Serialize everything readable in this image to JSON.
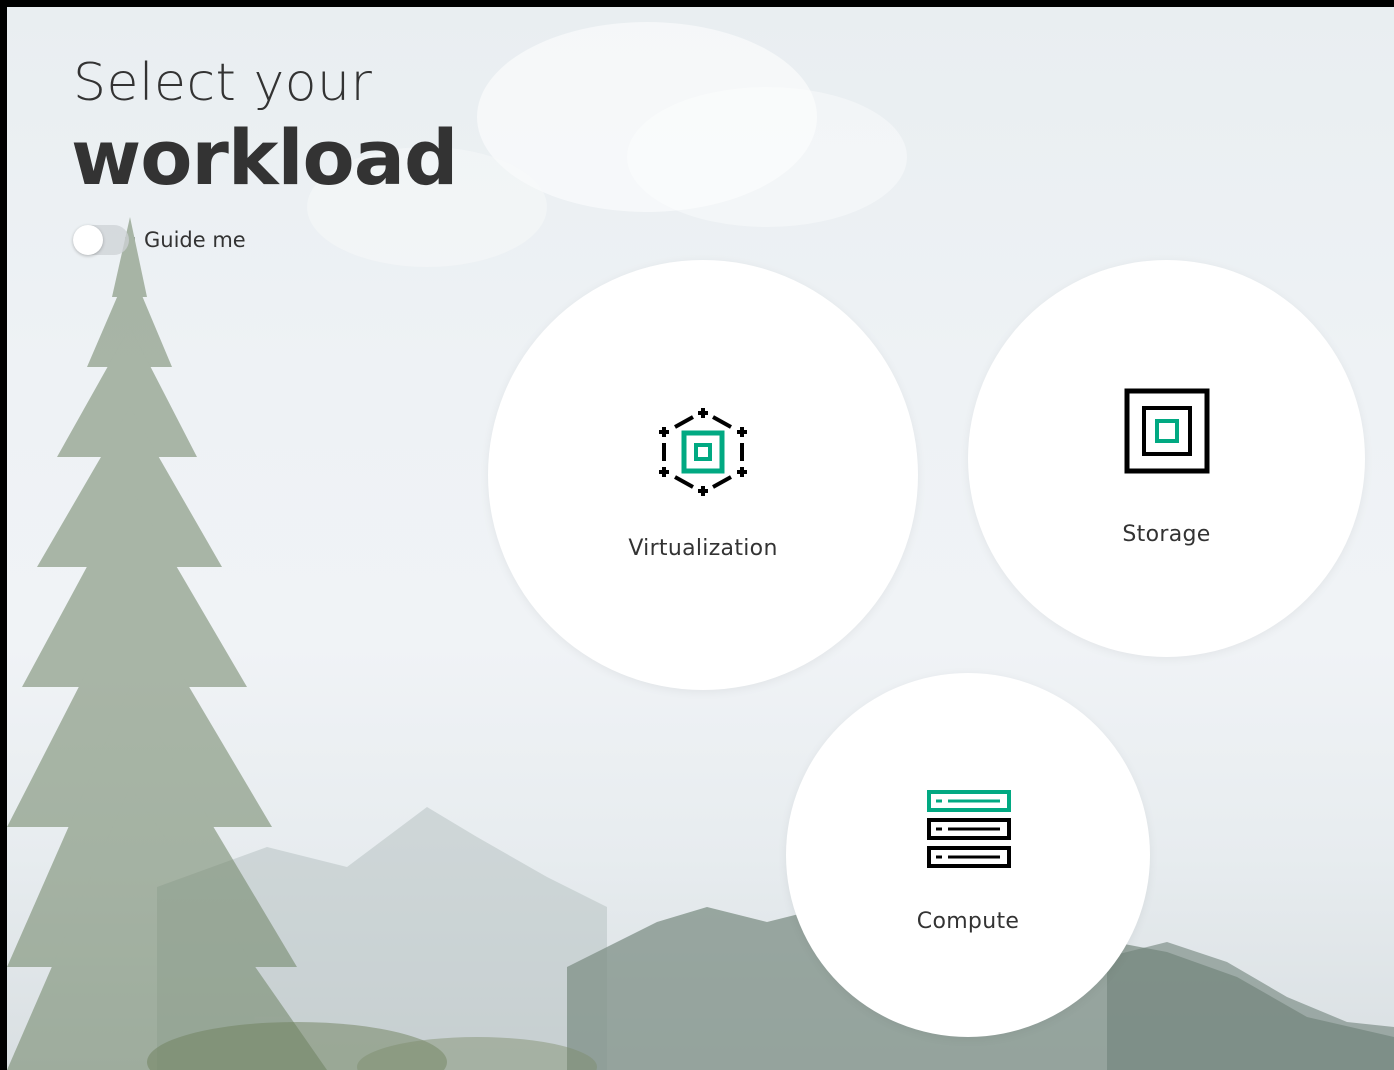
{
  "heading": {
    "line1": "Select your",
    "line2": "workload"
  },
  "guide_toggle": {
    "label": "Guide me",
    "enabled": false
  },
  "workloads": [
    {
      "label": "Virtualization",
      "icon": "virtualization-icon"
    },
    {
      "label": "Storage",
      "icon": "storage-icon"
    },
    {
      "label": "Compute",
      "icon": "server-stack-icon"
    }
  ],
  "colors": {
    "accent": "#01a982",
    "text": "#333333",
    "tile_background": "#ffffff"
  }
}
